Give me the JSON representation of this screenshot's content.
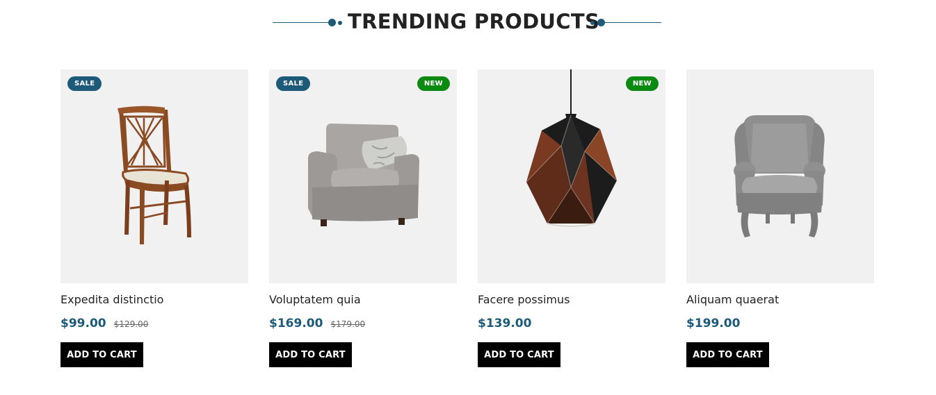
{
  "section": {
    "title": "TRENDING PRODUCTS",
    "accent_color": "#1d5a7a"
  },
  "products": [
    {
      "name": "Expedita distinctio",
      "price": "$99.00",
      "old_price": "$129.00",
      "badges": [
        "SALE"
      ],
      "image": "wooden-chair",
      "cta": "ADD TO CART"
    },
    {
      "name": "Voluptatem quia",
      "price": "$169.00",
      "old_price": "$179.00",
      "badges": [
        "SALE",
        "NEW"
      ],
      "image": "gray-armchair",
      "cta": "ADD TO CART"
    },
    {
      "name": "Facere possimus",
      "price": "$139.00",
      "old_price": "",
      "badges": [
        "NEW"
      ],
      "image": "geometric-pendant-lamp",
      "cta": "ADD TO CART"
    },
    {
      "name": "Aliquam quaerat",
      "price": "$199.00",
      "old_price": "",
      "badges": [],
      "image": "wingback-chair",
      "cta": "ADD TO CART"
    }
  ],
  "badge_colors": {
    "sale": "#1d5a7a",
    "new": "#0b8a12"
  }
}
